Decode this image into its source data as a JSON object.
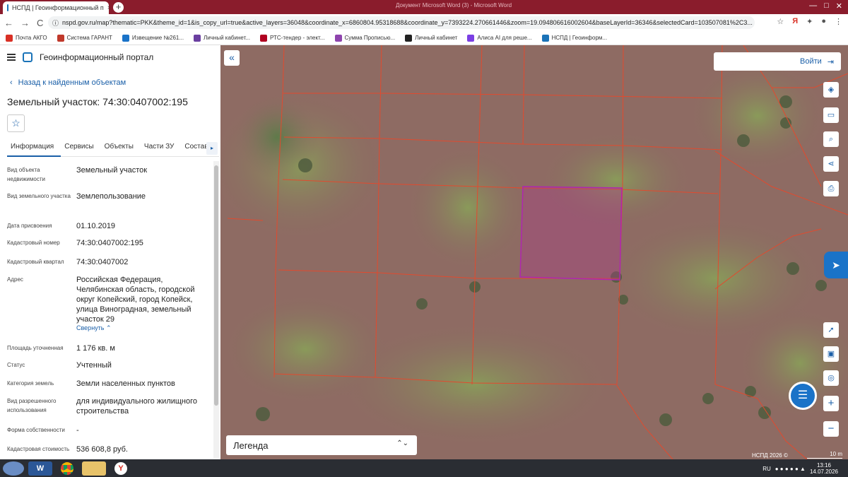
{
  "browser": {
    "tab_title": "НСПД | Геоинформационный п",
    "tab_close": "×",
    "new_tab": "+",
    "window_caption": "Документ Microsoft Word (3) - Microsoft Word",
    "win_min": "—",
    "win_max": "□",
    "win_close": "✕",
    "nav_back": "←",
    "nav_forward": "→",
    "nav_reload": "C",
    "url": "nspd.gov.ru/map?thematic=PKK&theme_id=1&is_copy_url=true&active_layers=36048&coordinate_x=6860804.95318688&coordinate_y=7393224.270661446&zoom=19.094806616002604&baseLayerId=36346&selectedCard=103507081%2C3...",
    "yandex_letter": "Я",
    "bookmarks": [
      {
        "label": "Почта АКГО",
        "color": "#d93025"
      },
      {
        "label": "Система ГАРАНТ",
        "color": "#c0392b"
      },
      {
        "label": "Извещение №261...",
        "color": "#1a73c8"
      },
      {
        "label": "Личный кабинет...",
        "color": "#6a3fa0"
      },
      {
        "label": "РТС-тендер - элект...",
        "color": "#b00020"
      },
      {
        "label": "Сумма Прописью...",
        "color": "#8e44ad"
      },
      {
        "label": "Личный кабинет",
        "color": "#222222"
      },
      {
        "label": "Алиса AI для реше...",
        "color": "#7b3fe4"
      },
      {
        "label": "НСПД | Геоинформ...",
        "color": "#1a73b8"
      }
    ]
  },
  "sidebar": {
    "app_title": "Геоинформационный портал",
    "back_label": "Назад к найденным объектам",
    "object_title": "Земельный участок: 74:30:0407002:195",
    "star_icon": "☆",
    "tabs": [
      "Информация",
      "Сервисы",
      "Объекты",
      "Части ЗУ",
      "Состав"
    ],
    "tab_arrow": "▸",
    "props": [
      {
        "key": "Вид объекта недвижимости",
        "value": "Земельный участок"
      },
      {
        "key": "Вид земельного участка",
        "value": "Землепользование"
      },
      {
        "key": "Дата присвоения",
        "value": "01.10.2019"
      },
      {
        "key": "Кадастровый номер",
        "value": "74:30:0407002:195"
      },
      {
        "key": "Кадастровый квартал",
        "value": "74:30:0407002"
      },
      {
        "key": "Адрес",
        "value": "Российская Федерация, Челябинская область, городской округ Копейский, город Копейск, улица Виноградная, земельный участок 29"
      },
      {
        "key": "Площадь уточненная",
        "value": "1 176 кв. м"
      },
      {
        "key": "Статус",
        "value": "Учтенный"
      },
      {
        "key": "Категория земель",
        "value": "Земли населенных пунктов"
      },
      {
        "key": "Вид разрешенного использования",
        "value": "для индивидуального жилищного строительства"
      },
      {
        "key": "Форма собственности",
        "value": "-"
      },
      {
        "key": "Кадастровая стоимость",
        "value": "536 608,8 руб."
      }
    ],
    "collapse_label": "Свернуть"
  },
  "map": {
    "collapse_icon": "«",
    "login_label": "Войти",
    "legend_label": "Легенда",
    "copyright": "НСПД 2026 ©",
    "scale_label": "10 m",
    "zoom_in": "+",
    "zoom_out": "−",
    "tools": [
      "layers-icon",
      "ruler-icon",
      "search-area-icon",
      "share-icon",
      "print-icon",
      "navigate-icon",
      "minimap-icon",
      "location-icon"
    ]
  },
  "taskbar": {
    "word_letter": "W",
    "yandex_letter": "Y",
    "lang": "RU",
    "time": "13:16",
    "date": "14.07.2026"
  }
}
